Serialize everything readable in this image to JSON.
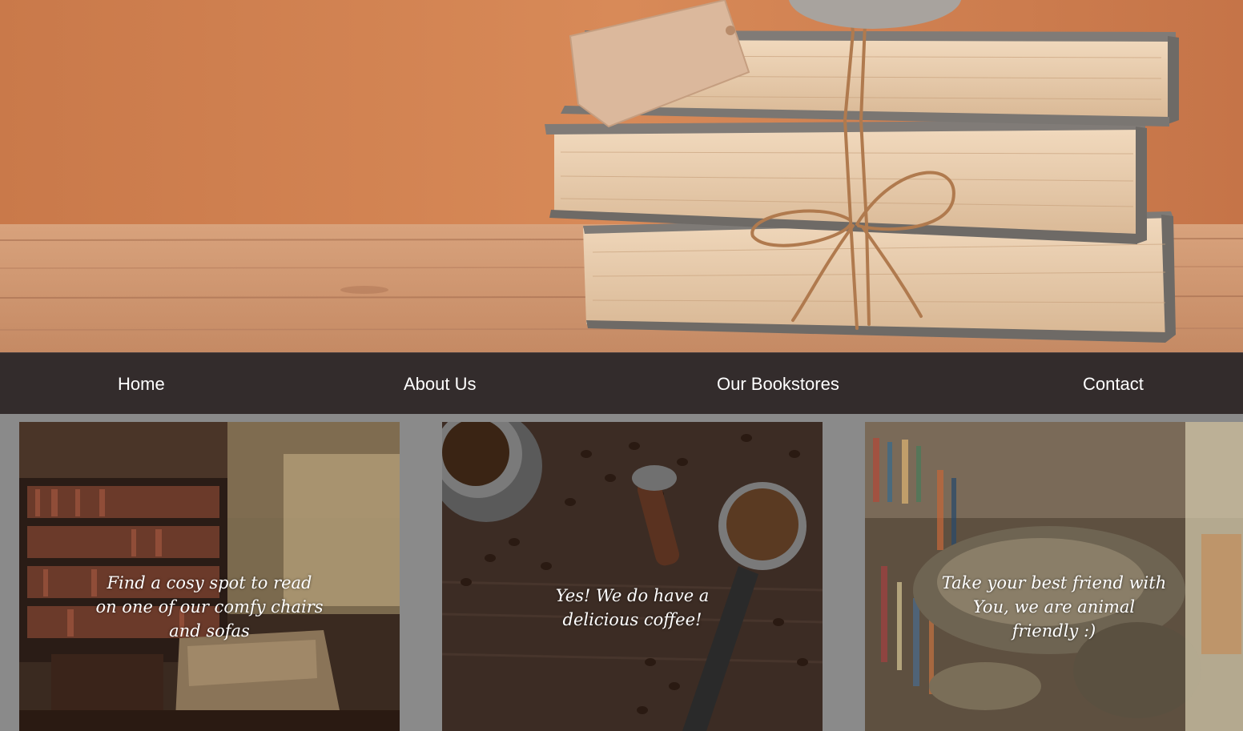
{
  "nav": {
    "items": [
      {
        "label": "Home"
      },
      {
        "label": "About Us"
      },
      {
        "label": "Our Bookstores"
      },
      {
        "label": "Contact"
      }
    ]
  },
  "cards": [
    {
      "caption": "Find a cosy spot to read\non one of our comfy chairs\nand sofas",
      "image": "bookstore-interior"
    },
    {
      "caption": "Yes! We do have a\ndelicious coffee!",
      "image": "coffee-beans-espresso"
    },
    {
      "caption": "Take your best friend with\nYou, we are animal\nfriendly :)",
      "image": "cat-sleeping-on-books"
    }
  ],
  "hero": {
    "image": "stacked-old-books-tied-with-twine"
  },
  "colors": {
    "nav_bg": "#332c2c",
    "page_bg": "#8a8a8a",
    "nav_text": "#ffffff"
  }
}
